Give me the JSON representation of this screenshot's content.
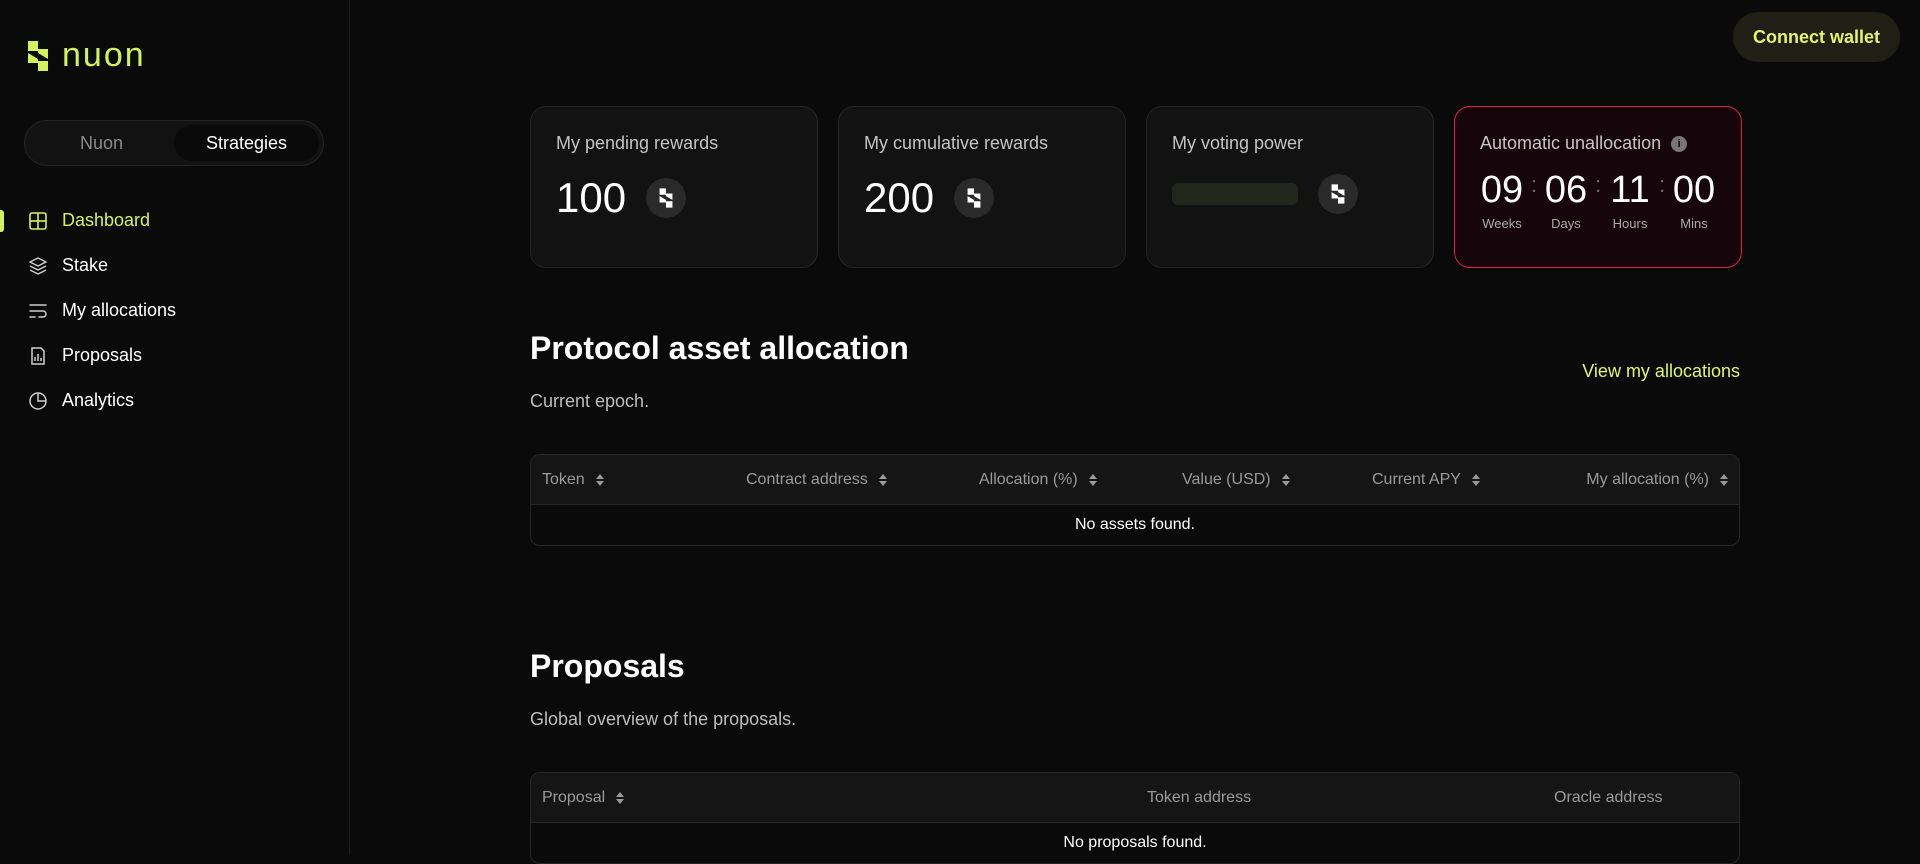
{
  "brand": {
    "name": "nuon",
    "accent": "#d6f25a",
    "alert": "#e01a4f"
  },
  "toggle": {
    "options": [
      "Nuon",
      "Strategies"
    ],
    "selected": "Strategies"
  },
  "sidebar": {
    "items": [
      {
        "label": "Dashboard",
        "icon": "grid-icon",
        "active": true
      },
      {
        "label": "Stake",
        "icon": "layers-icon"
      },
      {
        "label": "My allocations",
        "icon": "list-wrap-icon"
      },
      {
        "label": "Proposals",
        "icon": "document-chart-icon"
      },
      {
        "label": "Analytics",
        "icon": "pie-chart-icon"
      }
    ]
  },
  "header": {
    "connect_label": "Connect wallet"
  },
  "cards": {
    "pending": {
      "title": "My pending rewards",
      "value": "100",
      "icon": "nuon-token-icon"
    },
    "cumulative": {
      "title": "My cumulative rewards",
      "value": "200",
      "icon": "nuon-token-icon"
    },
    "voting": {
      "title": "My voting power",
      "icon": "nuon-token-icon"
    },
    "unallocation": {
      "title": "Automatic unallocation",
      "info_icon": "info-icon",
      "weeks": "09",
      "days": "06",
      "hours": "11",
      "mins": "00",
      "weeks_label": "Weeks",
      "days_label": "Days",
      "hours_label": "Hours",
      "mins_label": "Mins"
    }
  },
  "allocation": {
    "title": "Protocol asset allocation",
    "subtitle": "Current epoch.",
    "link": "View my allocations",
    "columns": [
      "Token",
      "Contract address",
      "Allocation (%)",
      "Value (USD)",
      "Current APY",
      "My allocation (%)"
    ],
    "empty": "No assets found."
  },
  "proposals": {
    "title": "Proposals",
    "subtitle": "Global overview of the proposals.",
    "columns": [
      "Proposal",
      "Token address",
      "Oracle address"
    ],
    "empty": "No proposals found."
  }
}
